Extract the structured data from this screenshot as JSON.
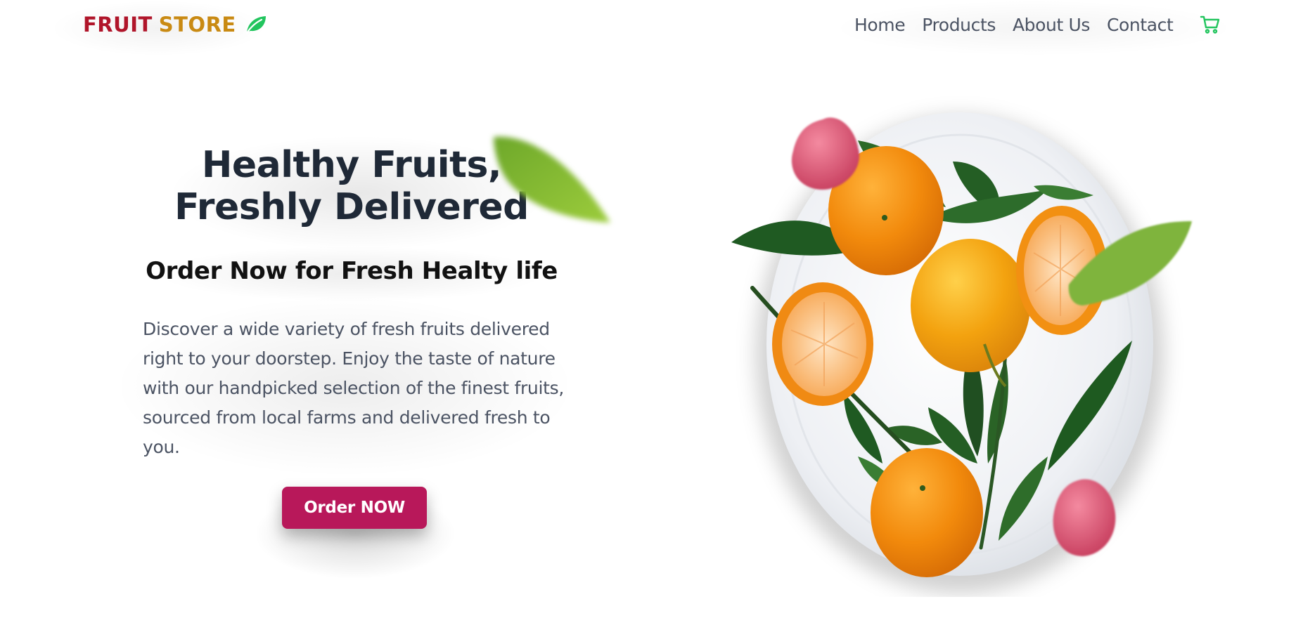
{
  "header": {
    "logo_word1": "FRUIT",
    "logo_word2": "STORE",
    "logo_icon": "leaf-icon",
    "nav": [
      {
        "label": "Home"
      },
      {
        "label": "Products"
      },
      {
        "label": "About Us"
      },
      {
        "label": "Contact"
      }
    ],
    "cart_icon": "cart-icon"
  },
  "hero": {
    "title_line1": "Healthy Fruits,",
    "title_line2": "Freshly Delivered",
    "subtitle": "Order Now for Fresh Healty life",
    "description": "Discover a wide variety of fresh fruits delivered right to your doorstep. Enjoy the taste of nature with our handpicked selection of the finest fruits, sourced from local farms and delivered fresh to you.",
    "cta_label": "Order NOW"
  },
  "colors": {
    "logo_red": "#b0152a",
    "logo_gold": "#c98a13",
    "accent_green": "#22c55e",
    "heading": "#1f2937",
    "body_text": "#4b5363",
    "cta_bg": "#b8185a"
  }
}
